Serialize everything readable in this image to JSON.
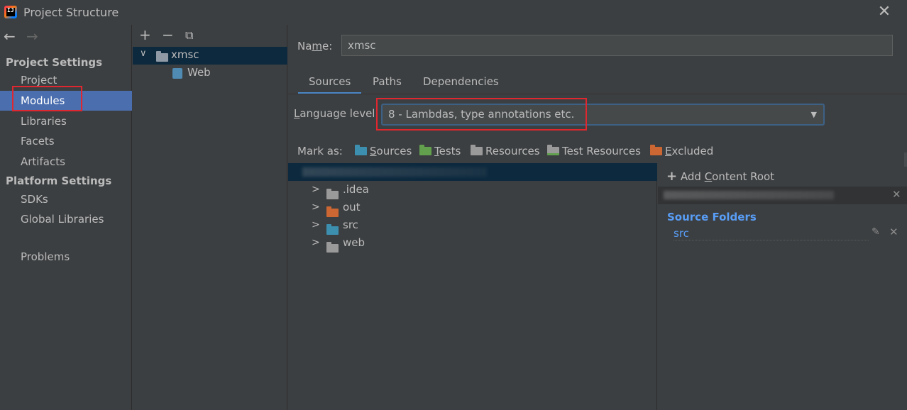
{
  "window": {
    "title": "Project Structure"
  },
  "nav": {
    "project_settings_header": "Project Settings",
    "project_settings_items": [
      "Project",
      "Modules",
      "Libraries",
      "Facets",
      "Artifacts"
    ],
    "platform_settings_header": "Platform Settings",
    "platform_settings_items": [
      "SDKs",
      "Global Libraries"
    ],
    "problems": "Problems",
    "selected": "Modules"
  },
  "module_tree": {
    "items": [
      {
        "label": "xmsc",
        "level": 0,
        "expanded": true,
        "selected": true
      },
      {
        "label": "Web",
        "level": 1
      }
    ]
  },
  "name_field": {
    "label_pre": "Na",
    "label_mnemonic": "m",
    "label_post": "e:",
    "value": "xmsc"
  },
  "tabs": [
    {
      "label": "Sources",
      "active": true
    },
    {
      "label": "Paths"
    },
    {
      "label": "Dependencies"
    }
  ],
  "language_level": {
    "label_mnemonic": "L",
    "label_rest": "anguage level:",
    "value": "8 - Lambdas, type annotations etc."
  },
  "mark_as": {
    "label": "Mark as:",
    "buttons": [
      {
        "mnemonic": "S",
        "rest": "ources",
        "color": "#3d8fb0"
      },
      {
        "mnemonic": "T",
        "rest": "ests",
        "color": "#62a04e"
      },
      {
        "mnemonic": "",
        "rest": "Resources",
        "color": "#9a9a9a"
      },
      {
        "mnemonic": "",
        "rest": "Test Resources",
        "color": "#9a9a9a"
      },
      {
        "mnemonic": "E",
        "rest": "xcluded",
        "color": "#cc6632"
      }
    ]
  },
  "file_tree": {
    "folders": [
      {
        "name": ".idea",
        "color": "#9a9a9a"
      },
      {
        "name": "out",
        "color": "#cc6632"
      },
      {
        "name": "src",
        "color": "#3d8fb0"
      },
      {
        "name": "web",
        "color": "#9a9a9a"
      }
    ]
  },
  "content_root": {
    "add_label_pre": "Add ",
    "add_label_mnemonic": "C",
    "add_label_post": "ontent Root",
    "source_folders_title": "Source Folders",
    "source_folders": [
      "src"
    ]
  },
  "colors": {
    "background": "#3c3f41",
    "selection": "#4b6eaf",
    "tree_selection": "#0d293e",
    "highlight_box": "#e0262e",
    "link": "#589df6"
  }
}
